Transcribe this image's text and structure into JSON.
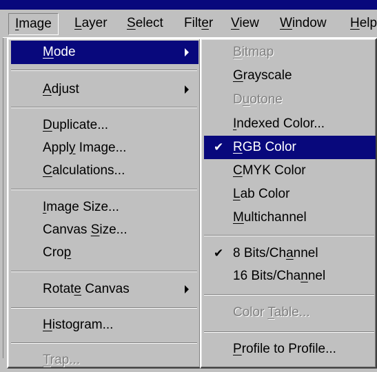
{
  "menubar": {
    "items": [
      {
        "pre": "",
        "u": "I",
        "post": "mage"
      },
      {
        "pre": "",
        "u": "L",
        "post": "ayer"
      },
      {
        "pre": "",
        "u": "S",
        "post": "elect"
      },
      {
        "pre": "Filt",
        "u": "e",
        "post": "r"
      },
      {
        "pre": "",
        "u": "V",
        "post": "iew"
      },
      {
        "pre": "",
        "u": "W",
        "post": "indow"
      },
      {
        "pre": "",
        "u": "H",
        "post": "elp"
      }
    ]
  },
  "image_menu": {
    "mode": {
      "pre": "",
      "u": "M",
      "post": "ode"
    },
    "adjust": {
      "pre": "",
      "u": "A",
      "post": "djust"
    },
    "duplicate": {
      "pre": "",
      "u": "D",
      "post": "uplicate..."
    },
    "apply_image": {
      "pre": "Appl",
      "u": "y",
      "post": " Image..."
    },
    "calculations": {
      "pre": "",
      "u": "C",
      "post": "alculations..."
    },
    "image_size": {
      "pre": "",
      "u": "I",
      "post": "mage Size..."
    },
    "canvas_size": {
      "pre": "Canvas ",
      "u": "S",
      "post": "ize..."
    },
    "crop": {
      "pre": "Cro",
      "u": "p",
      "post": ""
    },
    "rotate_canvas": {
      "pre": "Rotat",
      "u": "e",
      "post": " Canvas"
    },
    "histogram": {
      "pre": "",
      "u": "H",
      "post": "istogram..."
    },
    "trap": {
      "pre": "",
      "u": "T",
      "post": "rap..."
    }
  },
  "mode_menu": {
    "bitmap": {
      "pre": "",
      "u": "B",
      "post": "itmap"
    },
    "grayscale": {
      "pre": "",
      "u": "G",
      "post": "rayscale"
    },
    "duotone": {
      "pre": "D",
      "u": "u",
      "post": "otone"
    },
    "indexed_color": {
      "pre": "",
      "u": "I",
      "post": "ndexed Color..."
    },
    "rgb_color": {
      "pre": "",
      "u": "R",
      "post": "GB Color"
    },
    "cmyk_color": {
      "pre": "",
      "u": "C",
      "post": "MYK Color"
    },
    "lab_color": {
      "pre": "",
      "u": "L",
      "post": "ab Color"
    },
    "multichannel": {
      "pre": "",
      "u": "M",
      "post": "ultichannel"
    },
    "bits8": {
      "pre": "8 Bits/Ch",
      "u": "a",
      "post": "nnel"
    },
    "bits16": {
      "pre": "16 Bits/Cha",
      "u": "n",
      "post": "nel"
    },
    "color_table": {
      "pre": "Color ",
      "u": "T",
      "post": "able..."
    },
    "profile_to_profile": {
      "pre": "",
      "u": "P",
      "post": "rofile to Profile..."
    },
    "check_glyph": "✔"
  },
  "colors": {
    "highlight": "#08087c",
    "menu_face": "#c0c0c0",
    "disabled": "#808080"
  }
}
